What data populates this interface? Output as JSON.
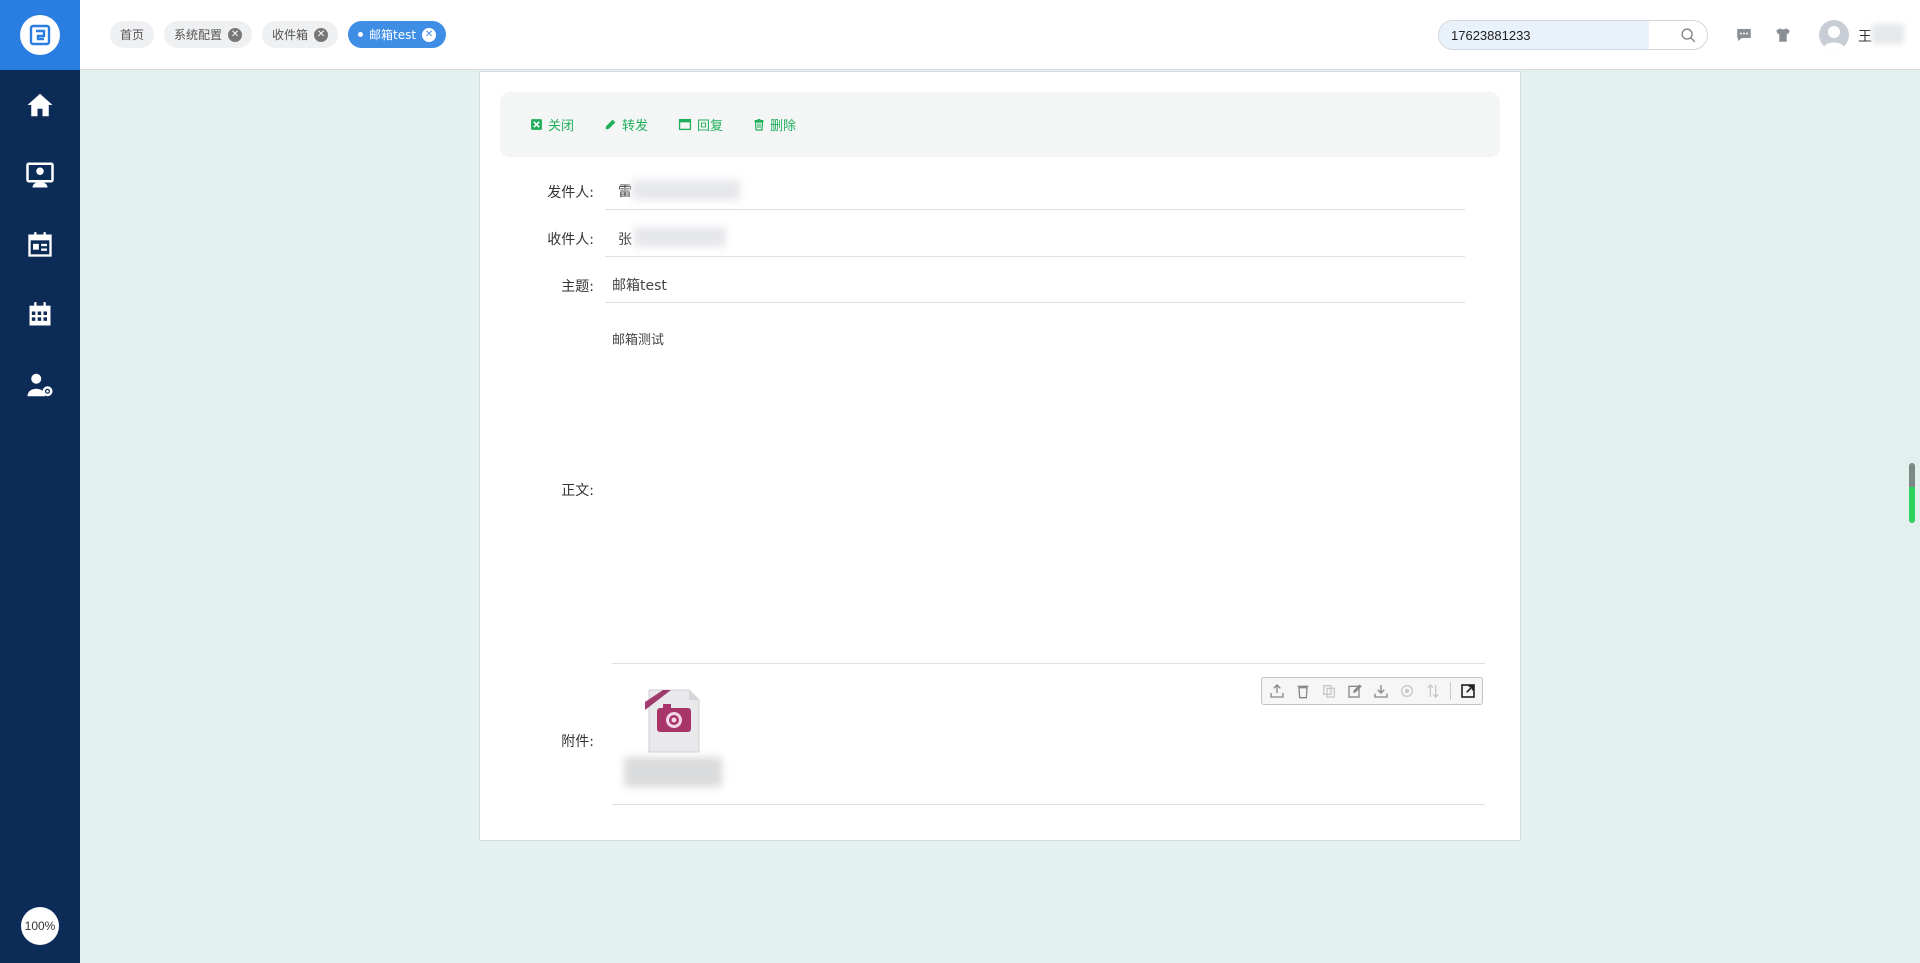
{
  "sidebar": {
    "logo_icon": "app-logo-icon",
    "items": [
      {
        "icon": "home-icon"
      },
      {
        "icon": "user-monitor-icon"
      },
      {
        "icon": "news-calendar-icon"
      },
      {
        "icon": "calendar-grid-icon"
      },
      {
        "icon": "user-settings-icon"
      }
    ],
    "zoom": "100%"
  },
  "tabs": [
    {
      "label": "首页",
      "active": false,
      "closable": false
    },
    {
      "label": "系统配置",
      "active": false,
      "closable": true
    },
    {
      "label": "收件箱",
      "active": false,
      "closable": true
    },
    {
      "label": "邮箱test",
      "active": true,
      "closable": true
    }
  ],
  "search": {
    "value": "17623881233"
  },
  "user": {
    "name": "王"
  },
  "toolbar": {
    "close_label": "关闭",
    "forward_label": "转发",
    "reply_label": "回复",
    "delete_label": "删除"
  },
  "email": {
    "sender_label": "发件人:",
    "sender_value": "雷",
    "recipient_label": "收件人:",
    "recipient_value": "张",
    "subject_label": "主题:",
    "subject_value": "邮箱test",
    "body_label": "正文:",
    "body_value": "邮箱测试",
    "attachment_label": "附件:"
  },
  "colors": {
    "sidebar_bg": "#0d2b57",
    "logo_bg": "#2a7de1",
    "accent_green": "#1fae5a",
    "active_tab": "#3e8ee6",
    "page_bg": "#e3f1ee"
  }
}
